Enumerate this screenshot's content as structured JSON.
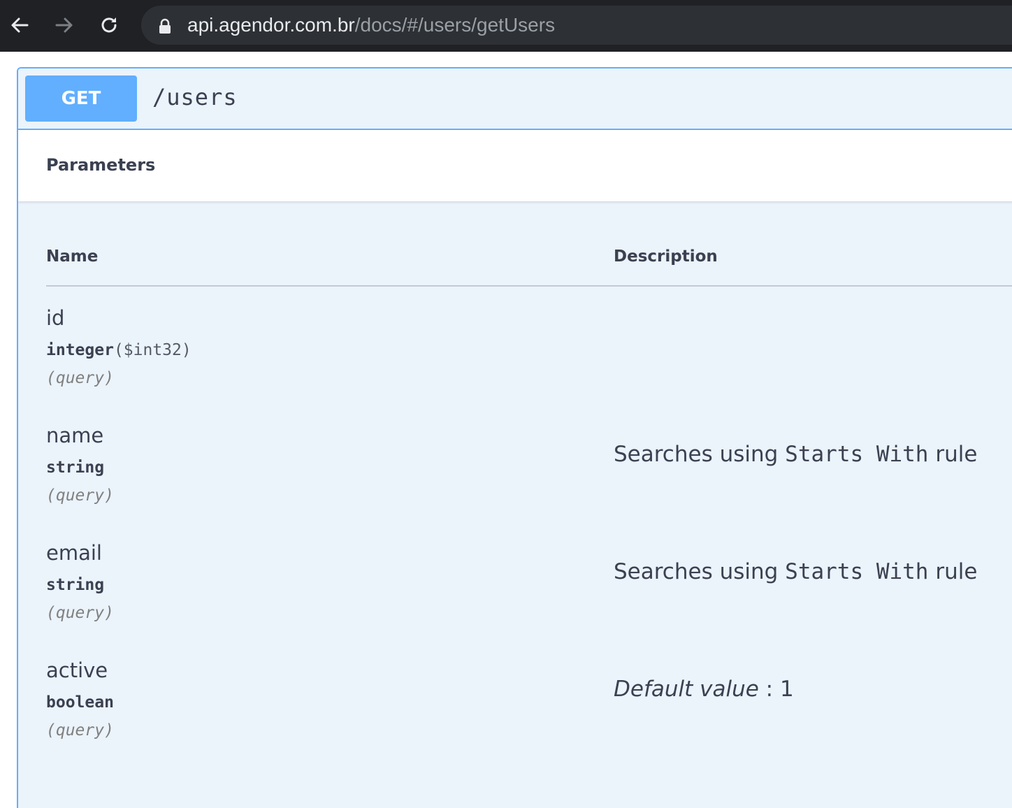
{
  "browser": {
    "url_host": "api.agendor.com.br",
    "url_path": "/docs/#/users/getUsers",
    "icons": [
      "back-arrow-icon",
      "forward-arrow-icon",
      "reload-icon",
      "lock-icon"
    ]
  },
  "operation": {
    "method": "GET",
    "path": "/users",
    "method_color": "#61affe"
  },
  "parameters": {
    "title": "Parameters",
    "columns": {
      "name": "Name",
      "description": "Description"
    },
    "rows": [
      {
        "name": "id",
        "type": "integer",
        "format": "($int32)",
        "in": "(query)"
      },
      {
        "name": "name",
        "type": "string",
        "in": "(query)",
        "desc_pre": "Searches using ",
        "desc_code": "Starts With",
        "desc_post": " rule"
      },
      {
        "name": "email",
        "type": "string",
        "in": "(query)",
        "desc_pre": "Searches using ",
        "desc_code": "Starts With",
        "desc_post": " rule"
      },
      {
        "name": "active",
        "type": "boolean",
        "in": "(query)",
        "default_label": "Default value",
        "default_sep": " : ",
        "default_value": "1"
      }
    ]
  }
}
